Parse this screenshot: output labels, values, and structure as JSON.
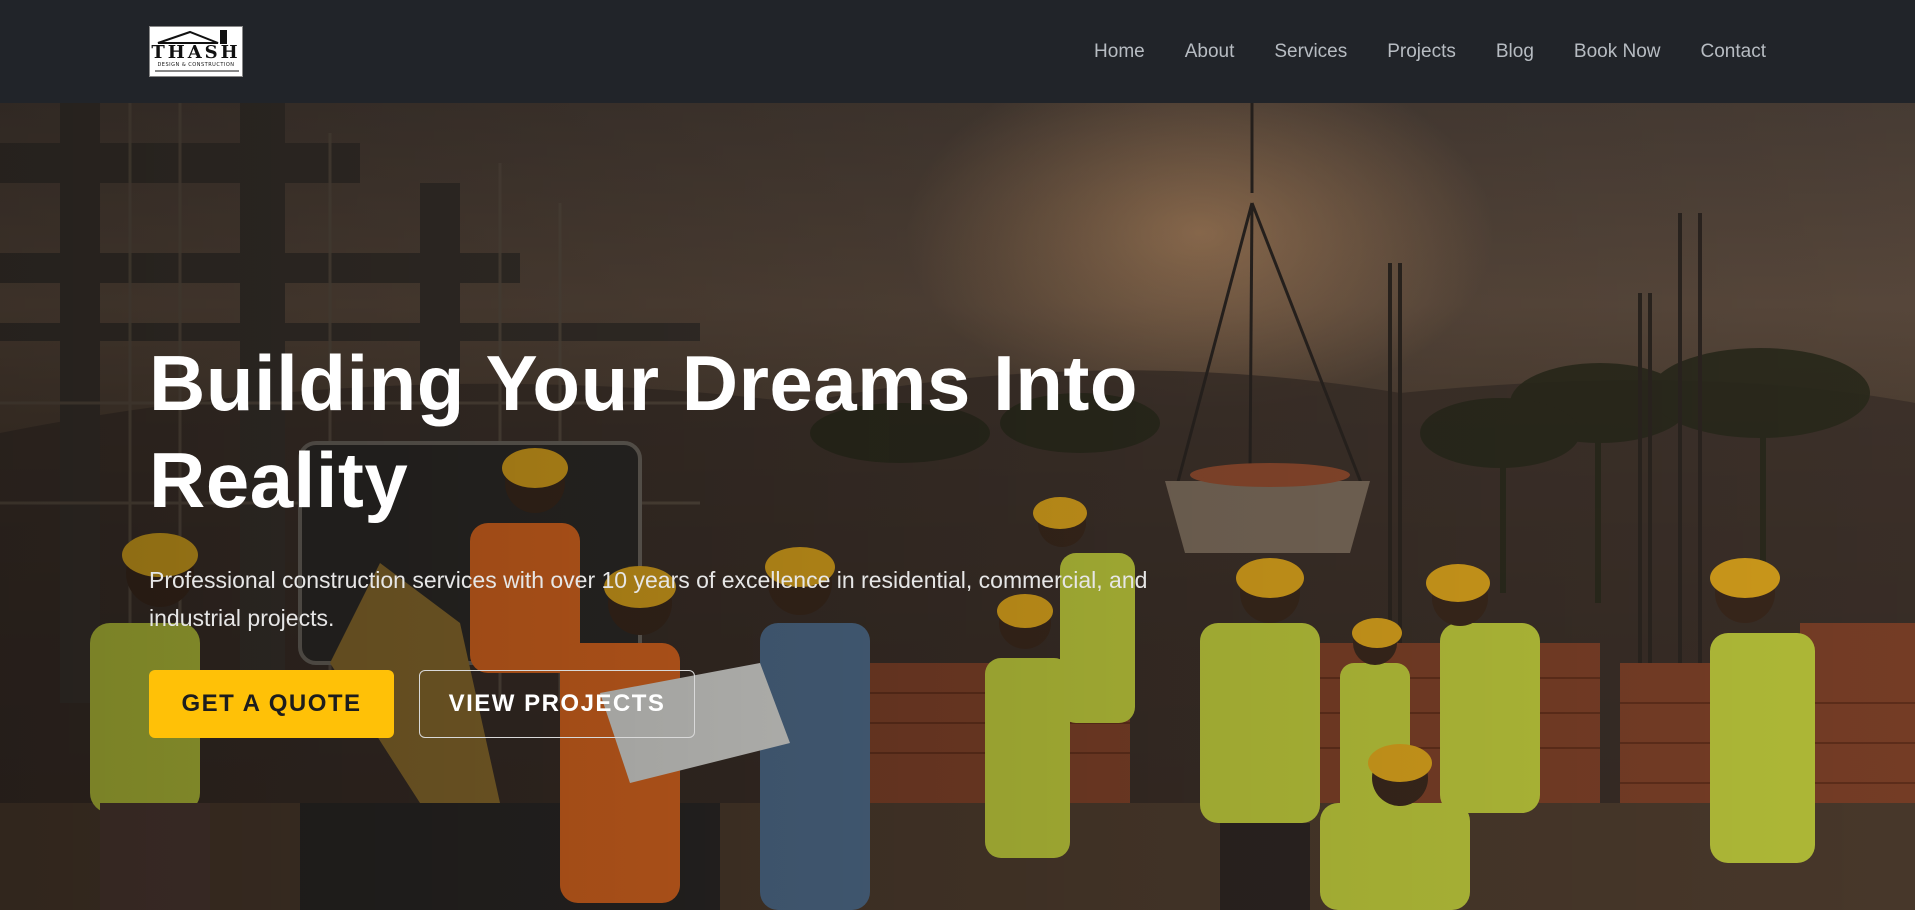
{
  "brand": {
    "logo_name": "THASH",
    "logo_tagline": "DESIGN & CONSTRUCTION"
  },
  "nav": {
    "items": [
      {
        "label": "Home"
      },
      {
        "label": "About"
      },
      {
        "label": "Services"
      },
      {
        "label": "Projects"
      },
      {
        "label": "Blog"
      },
      {
        "label": "Book Now"
      },
      {
        "label": "Contact"
      }
    ]
  },
  "hero": {
    "title": "Building Your Dreams Into Reality",
    "subtitle": "Professional construction services with over 10 years of excellence in residential, commercial, and industrial projects.",
    "primary_button": "GET A QUOTE",
    "secondary_button": "VIEW PROJECTS",
    "background_image": "construction-site-workers-photo"
  },
  "colors": {
    "navbar_bg": "#212429",
    "accent": "#ffc107",
    "nav_text": "#b7bcc2"
  }
}
